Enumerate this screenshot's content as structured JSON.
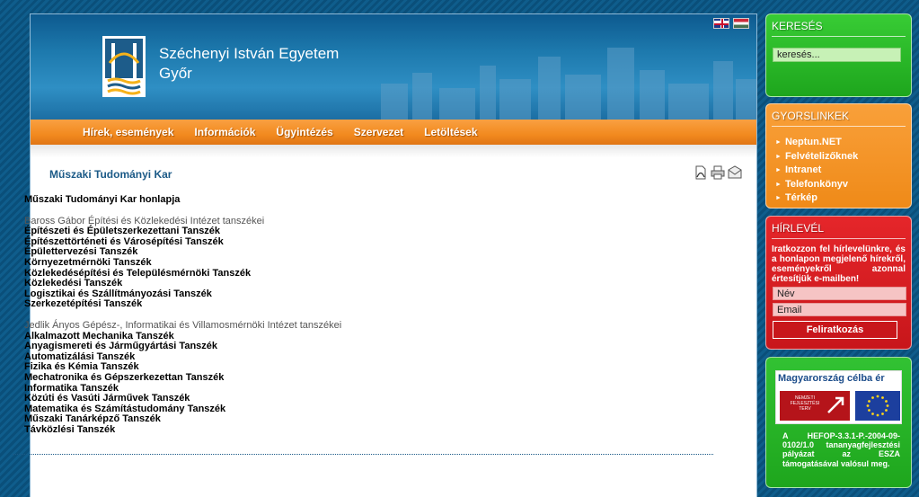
{
  "header": {
    "university_name": "Széchenyi István Egyetem",
    "city": "Győr",
    "languages": [
      "english-flag-icon",
      "hungarian-flag-icon"
    ]
  },
  "nav": {
    "items": [
      "Hírek, események",
      "Információk",
      "Ügyintézés",
      "Szervezet",
      "Letöltések"
    ]
  },
  "page": {
    "title": "Műszaki Tudományi Kar",
    "tools": [
      "pdf-icon",
      "print-icon",
      "email-icon"
    ]
  },
  "content": {
    "home_link": "Műszaki Tudományi Kar honlapja",
    "groups": [
      {
        "heading": "Baross Gábor Építési és Közlekedési Intézet tanszékei",
        "departments": [
          "Építészeti és Épületszerkezettani Tanszék",
          "Építészettörténeti és Városépítési Tanszék",
          "Épülettervezési Tanszék",
          "Környezetmérnöki Tanszék",
          "Közlekedésépítési és Településmérnöki Tanszék",
          "Közlekedési Tanszék",
          "Logisztikai és Szállítmányozási Tanszék",
          "Szerkezetépítési Tanszék"
        ]
      },
      {
        "heading": "Jedlik Ányos Gépész-, Informatikai és Villamosmérnöki Intézet tanszékei",
        "departments": [
          "Alkalmazott Mechanika Tanszék",
          "Anyagismereti és Járműgyártási Tanszék",
          "Automatizálási Tanszék",
          "Fizika és Kémia Tanszék",
          "Mechatronika és Gépszerkezettan Tanszék",
          "Informatika Tanszék",
          "Közúti és Vasúti Járművek Tanszék",
          "Matematika és Számítástudomány Tanszék",
          "Műszaki Tanárképző Tanszék",
          "Távközlési Tanszék"
        ]
      }
    ]
  },
  "sidebar": {
    "search": {
      "title": "KERESÉS",
      "placeholder": "keresés..."
    },
    "quicklinks": {
      "title": "GYORSLINKEK",
      "items": [
        "Neptun.NET",
        "Felvételizőknek",
        "Intranet",
        "Telefonkönyv",
        "Térkép"
      ]
    },
    "newsletter": {
      "title": "HÍRLEVÉL",
      "text": "Iratkozzon fel hírlevelünkre, és a honlapon megjelenő hírekről, eseményekről azonnal értesítjük e-mailben!",
      "name_value": "Név",
      "email_value": "Email",
      "button": "Feliratkozás"
    },
    "eu": {
      "slogan": "Magyarország célba ér",
      "nft_label": "NEMZETI FEJLESZTÉSI TERV",
      "text": "A HEFOP-3.3.1-P.-2004-09-0102/1.0 tananyagfejlesztési pályázat az ESZA támogatásával valósul meg."
    }
  }
}
